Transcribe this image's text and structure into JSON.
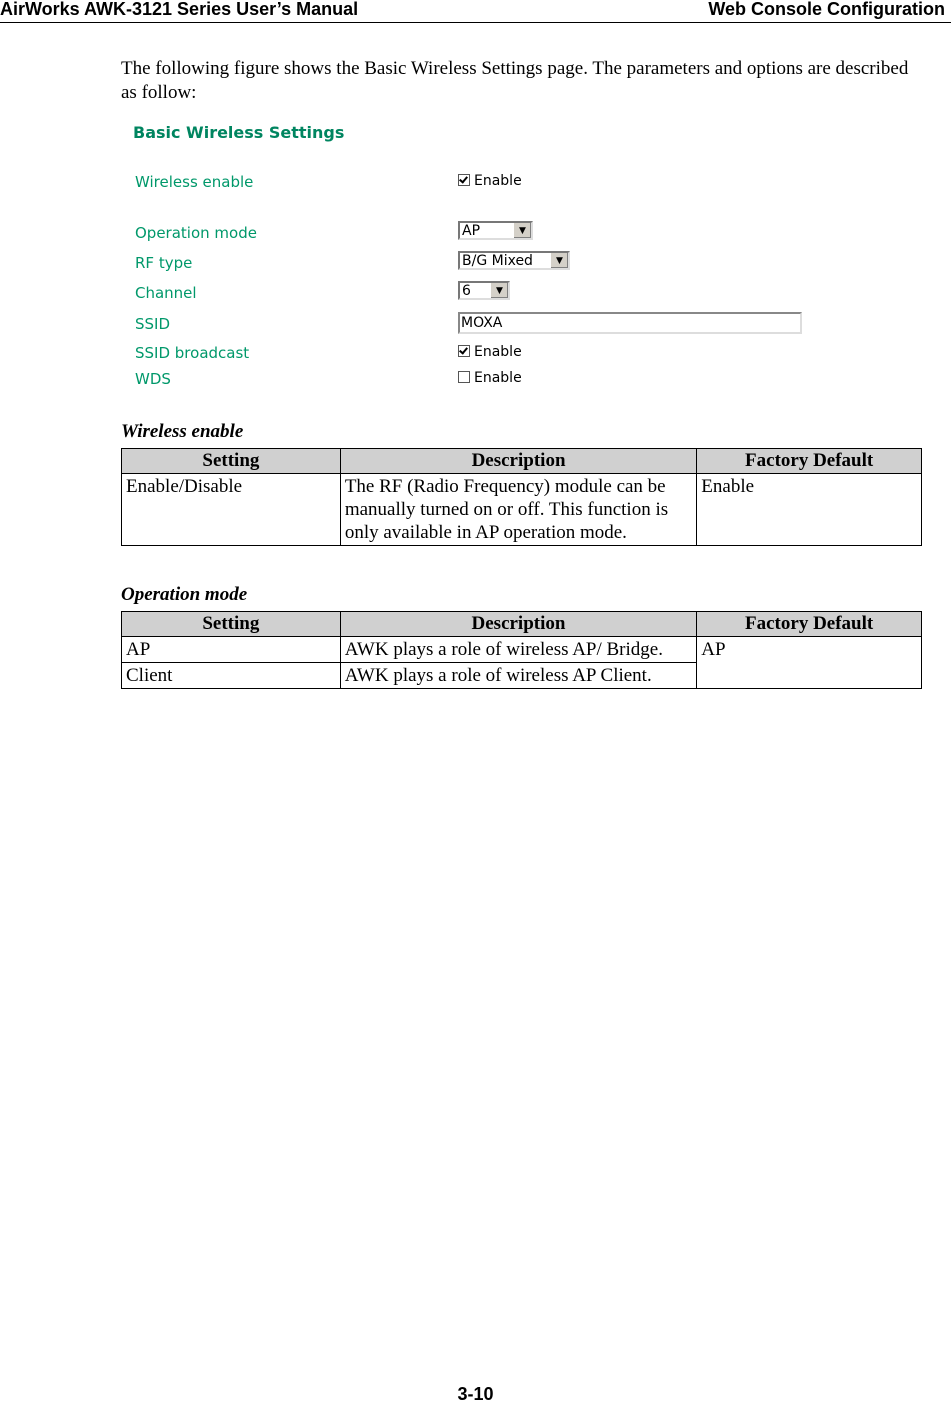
{
  "header": {
    "left": "AirWorks AWK-3121 Series User’s Manual",
    "right": "Web Console Configuration"
  },
  "intro": "The following figure shows the Basic Wireless Settings page. The parameters and options are described as follow:",
  "screenshot": {
    "title": "Basic Wireless Settings",
    "wireless_enable": {
      "label": "Wireless enable",
      "checkbox_label": "Enable",
      "checked": true
    },
    "operation_mode": {
      "label": "Operation mode",
      "value": "AP"
    },
    "rf_type": {
      "label": "RF type",
      "value": "B/G Mixed"
    },
    "channel": {
      "label": "Channel",
      "value": "6"
    },
    "ssid": {
      "label": "SSID",
      "value": "MOXA"
    },
    "ssid_broadcast": {
      "label": "SSID broadcast",
      "checkbox_label": "Enable",
      "checked": true
    },
    "wds": {
      "label": "WDS",
      "checkbox_label": "Enable",
      "checked": false
    }
  },
  "tables": {
    "wireless_enable": {
      "heading": "Wireless enable",
      "headers": [
        "Setting",
        "Description",
        "Factory Default"
      ],
      "rows": [
        [
          "Enable/Disable",
          "The RF (Radio Frequency) module can be manually turned on or off. This function is only available in AP operation mode.",
          "Enable"
        ]
      ]
    },
    "operation_mode": {
      "heading": "Operation mode",
      "headers": [
        "Setting",
        "Description",
        "Factory Default"
      ],
      "rows": [
        [
          "AP",
          "AWK plays a role of wireless AP/ Bridge.",
          "AP"
        ],
        [
          "Client",
          "AWK plays a role of wireless AP Client.",
          ""
        ]
      ]
    }
  },
  "footer": {
    "page_number": "3-10"
  }
}
